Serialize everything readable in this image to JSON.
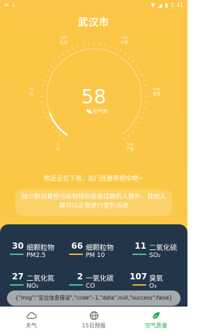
{
  "status_bar": {
    "left_icons": [
      "app-icon",
      "download-icon"
    ],
    "time": "1:41",
    "right_icons": [
      "wifi-icon",
      "signal-icon",
      "battery-icon"
    ]
  },
  "city": "武汉市",
  "gauge": {
    "ticks": [
      {
        "value": "0",
        "label": "优"
      },
      {
        "value": "50",
        "label": "良"
      },
      {
        "value": "100",
        "label": "轻度"
      },
      {
        "value": "150",
        "label": "中度"
      },
      {
        "value": "200",
        "label": "重度"
      },
      {
        "value": "300",
        "label": "严重"
      }
    ],
    "max": 500,
    "value_fraction": 0.116
  },
  "aqi": {
    "value": "58",
    "level": "空气良"
  },
  "tip": "附近正在下雨，出门还是带把伞吧~",
  "advice": "除少数对某些污染物特别容易过敏的人群外，其他人群可以正常进行室外活动",
  "pollutants": [
    {
      "value": "30",
      "name": "细颗粒物",
      "code": "PM2.5",
      "color": "#3ec8a8"
    },
    {
      "value": "66",
      "name": "细颗粒物",
      "code": "PM 10",
      "color": "#f0b43c"
    },
    {
      "value": "11",
      "name": "二氧化硫",
      "code": "SO₂",
      "color": "#3ec8a8"
    },
    {
      "value": "27",
      "name": "二氧化氮",
      "code": "NO₂",
      "color": "#3ec8a8"
    },
    {
      "value": "2",
      "name": "一氧化碳",
      "code": "CO",
      "color": "#3ec8a8"
    },
    {
      "value": "107",
      "name": "臭氧",
      "code": "O₃",
      "color": "#f0b43c"
    }
  ],
  "toast": "{\"msg\":\"定位信息错误\",\"code\":-1,\"data\":null,\"success\":false}",
  "tabs": [
    {
      "label": "天气",
      "icon": "cloud-icon",
      "active": false
    },
    {
      "label": "15日预报",
      "icon": "globe-icon",
      "active": false
    },
    {
      "label": "空气质量",
      "icon": "leaf-icon",
      "active": true
    }
  ],
  "colors": {
    "background": "#fcc545",
    "panel": "#233649",
    "active_tab": "#2aa84a"
  }
}
